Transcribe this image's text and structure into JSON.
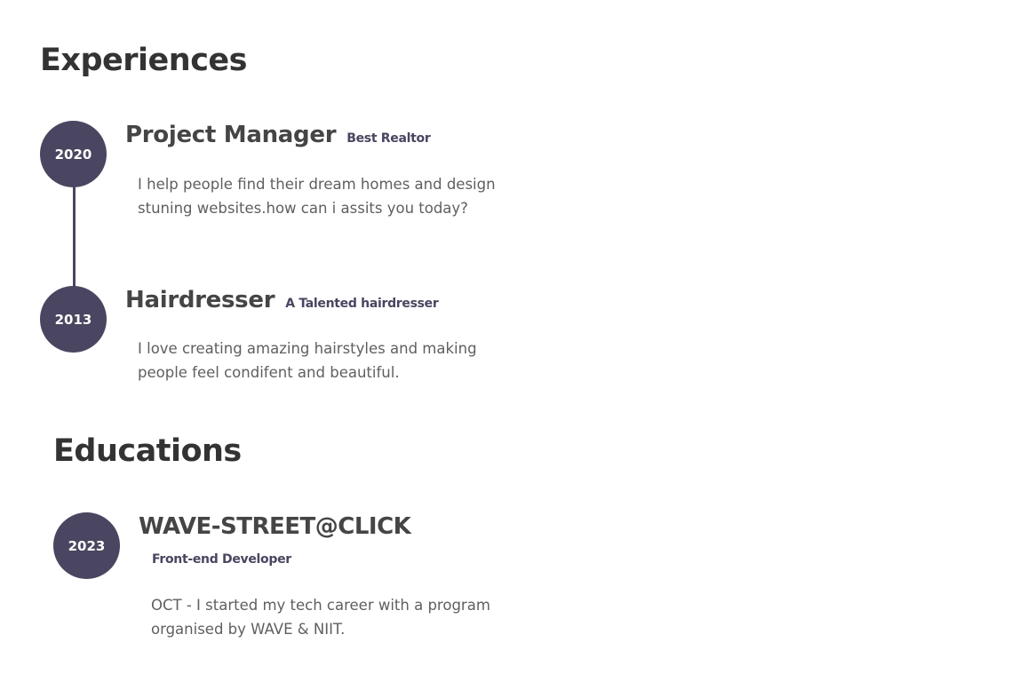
{
  "experiences": {
    "heading": "Experiences",
    "items": [
      {
        "year": "2020",
        "title": "Project Manager",
        "subtitle": "Best Realtor",
        "description": "I help people find their dream homes and design stuning websites.how can i assits you today?"
      },
      {
        "year": "2013",
        "title": "Hairdresser",
        "subtitle": "A Talented hairdresser",
        "description": "I love creating amazing hairstyles and making people feel condifent and beautiful."
      }
    ]
  },
  "educations": {
    "heading": "Educations",
    "items": [
      {
        "year": "2023",
        "title": "WAVE-STREET@CLICK",
        "subtitle": "Front-end Developer",
        "description": "OCT - I started my tech career with a program organised by WAVE & NIIT."
      }
    ]
  },
  "colors": {
    "accent": "#4a4560",
    "heading": "#333333",
    "body_text": "#5f5f5f"
  }
}
